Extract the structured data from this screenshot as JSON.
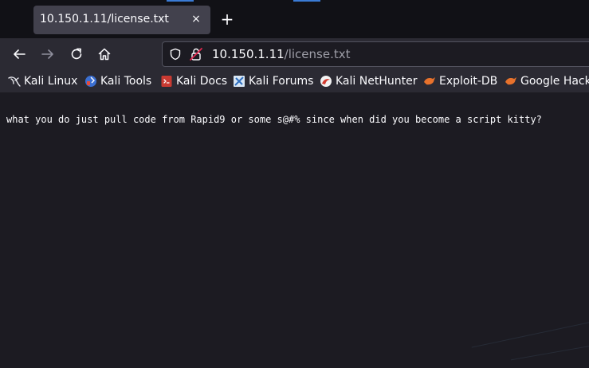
{
  "tabs": {
    "active_title": "10.150.1.11/license.txt",
    "close_symbol": "×",
    "new_tab_symbol": "+"
  },
  "navigation": {
    "back_icon": "back-arrow-icon",
    "forward_icon": "forward-arrow-icon",
    "reload_icon": "reload-icon",
    "home_icon": "home-icon"
  },
  "url_bar": {
    "host": "10.150.1.11",
    "path": "/license.txt"
  },
  "bookmarks": [
    {
      "label": "Kali Linux",
      "icon": "kali-dragon-icon"
    },
    {
      "label": "Kali Tools",
      "icon": "kali-tools-icon"
    },
    {
      "label": "Kali Docs",
      "icon": "kali-docs-icon"
    },
    {
      "label": "Kali Forums",
      "icon": "kali-forums-icon"
    },
    {
      "label": "Kali NetHunter",
      "icon": "kali-nethunter-icon"
    },
    {
      "label": "Exploit-DB",
      "icon": "exploit-db-icon"
    },
    {
      "label": "Google Hacking DB",
      "icon": "google-hacking-db-icon"
    }
  ],
  "page": {
    "text": "what you do just pull code from Rapid9 or some s@#% since when did you become a script kitty?"
  },
  "colors": {
    "tab_strip": "#111116",
    "toolbar": "#2b2a33",
    "active_tab": "#42414d",
    "page_background": "#1c1b22",
    "text": "#fbfbfe",
    "accent_blue": "#3a7bd5"
  }
}
